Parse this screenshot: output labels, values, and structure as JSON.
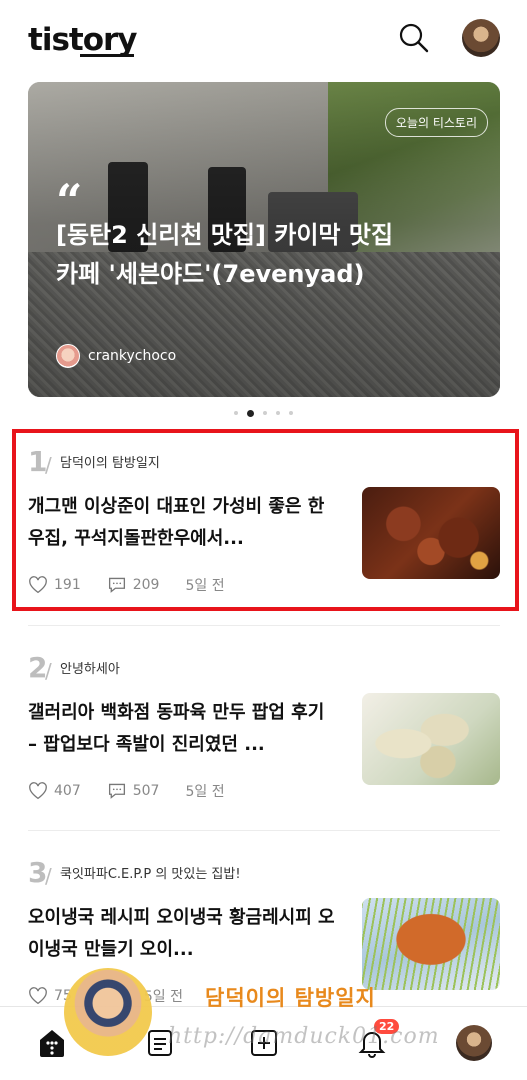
{
  "header": {
    "logo": "tistory"
  },
  "hero": {
    "tag": "오늘의 티스토리",
    "quote_mark": "“",
    "title": "[동탄2 신리천 맛집] 카이막 맛집 카페 '세븐야드'(7evenyad)",
    "author": "crankychoco"
  },
  "carousel": {
    "pages": 5,
    "active_index": 1
  },
  "list": [
    {
      "rank": "1",
      "blog": "담덕이의 탐방일지",
      "title": "개그맨 이상준이 대표인 가성비 좋은 한우집, 꾸석지돌판한우에서...",
      "likes": "191",
      "comments": "209",
      "time": "5일 전"
    },
    {
      "rank": "2",
      "blog": "안녕하세아",
      "title": "갤러리아 백화점 동파육 만두 팝업 후기 – 팝업보다 족발이 진리였던 ...",
      "likes": "407",
      "comments": "507",
      "time": "5일 전"
    },
    {
      "rank": "3",
      "blog": "쿡잇파파C.E.P.P 의 맛있는 집밥!",
      "title": "오이냉국 레시피 오이냉국 황금레시피 오이냉국 만들기 오이...",
      "likes": "75",
      "comments": "",
      "time": "5일 전"
    }
  ],
  "bottom_nav": {
    "notifications_badge": "22"
  },
  "watermark": {
    "text": "담덕이의 탐방일지",
    "url": "http://damduck01.com"
  }
}
